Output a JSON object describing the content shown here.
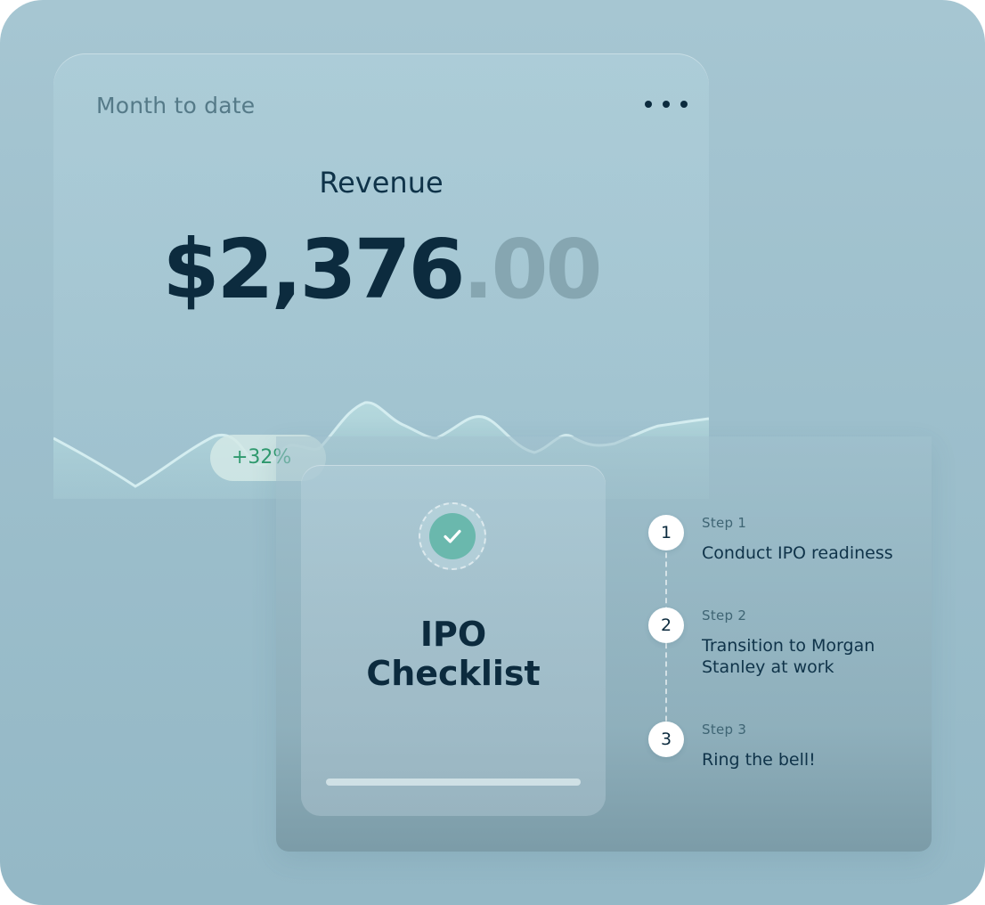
{
  "revenue_card": {
    "period": "Month to date",
    "metric": "Revenue",
    "amount_whole": "$2,376",
    "amount_cents": ".00",
    "change_badge": "+32%",
    "more_icon": "more-horizontal-icon"
  },
  "ipo_card": {
    "title_line1": "IPO",
    "title_line2": "Checklist",
    "check_icon": "checkmark-icon",
    "steps": [
      {
        "number": "1",
        "label": "Step 1",
        "text": "Conduct IPO readiness"
      },
      {
        "number": "2",
        "label": "Step 2",
        "text": "Transition to Morgan Stanley at work"
      },
      {
        "number": "3",
        "label": "Step 3",
        "text": "Ring the bell!"
      }
    ]
  },
  "colors": {
    "background": "#a0c2ce",
    "primary_text": "#0c2b3e",
    "muted_cents": "#86a6b1",
    "badge_text": "#2f9a6e",
    "check_fill": "#6ab8ad"
  }
}
